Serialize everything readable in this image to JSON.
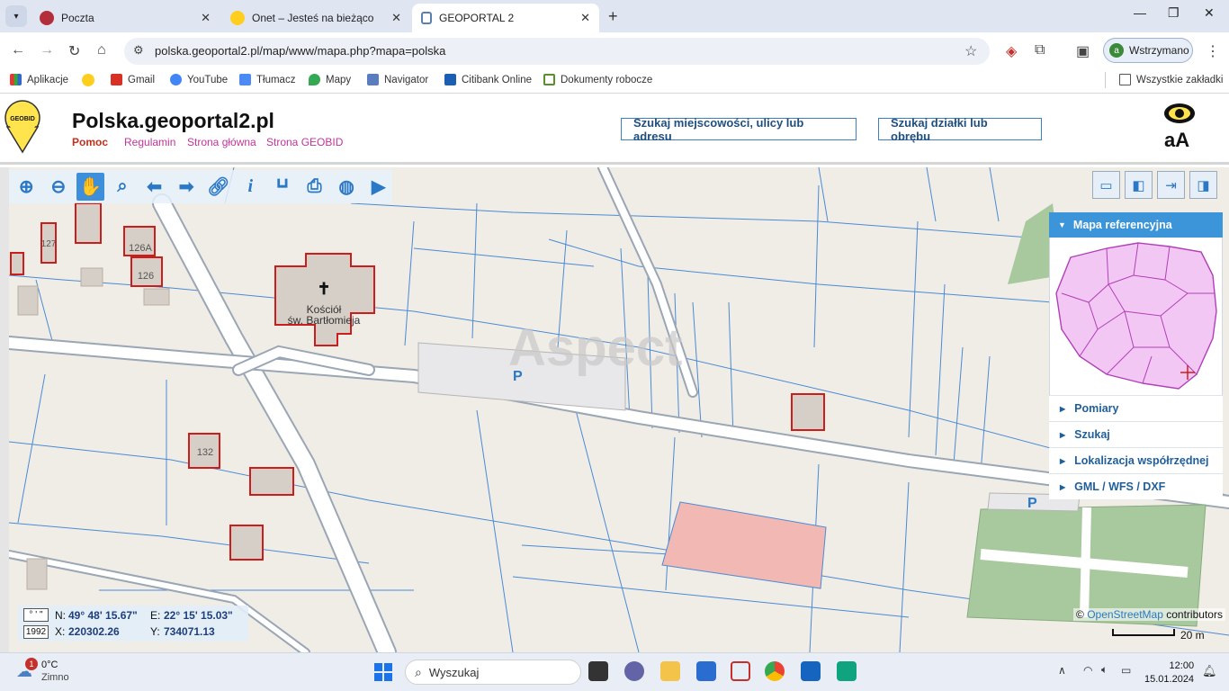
{
  "browser": {
    "tabs": [
      {
        "title": "Poczta",
        "active": false,
        "favicon_color": "#b32d3a"
      },
      {
        "title": "Onet – Jesteś na bieżąco",
        "active": false,
        "favicon_color": "#ffce1f"
      },
      {
        "title": "GEOPORTAL 2",
        "active": true,
        "favicon_color": "#5b7fb0"
      }
    ],
    "url": "polska.geoportal2.pl/map/www/mapa.php?mapa=polska",
    "profile_initial": "a",
    "profile_label": "Wstrzymano",
    "bookmarks": [
      {
        "label": "Aplikacje",
        "icon": "apps-icon"
      },
      {
        "label": "",
        "icon": "onet-dot-icon"
      },
      {
        "label": "Gmail",
        "icon": "gmail-icon"
      },
      {
        "label": "YouTube",
        "icon": "google-icon"
      },
      {
        "label": "Tłumacz",
        "icon": "translate-icon"
      },
      {
        "label": "Mapy",
        "icon": "maps-pin-icon"
      },
      {
        "label": "Navigator",
        "icon": "navigator-icon"
      },
      {
        "label": "Citibank Online",
        "icon": "citi-icon"
      },
      {
        "label": "Dokumenty robocze",
        "icon": "doc-icon"
      }
    ],
    "all_bookmarks": "Wszystkie zakładki"
  },
  "site": {
    "logo_text": "GEOBID",
    "title": "Polska.geoportal2.pl",
    "links": [
      "Pomoc",
      "Regulamin",
      "Strona główna",
      "Strona GEOBID"
    ],
    "search_place_button": "Szukaj miejscowości, ulicy lub adresu",
    "search_parcel_button": "Szukaj działki lub obrębu",
    "accessibility_label": "aA"
  },
  "map": {
    "watermark": "Aspect",
    "labels": {
      "church": "Kościół",
      "church_name": "św. Bartłomieja",
      "house_126a": "126A",
      "house_126": "126",
      "house_132": "132",
      "house_127": "127",
      "parking": "P"
    },
    "tools": [
      "zoom-in",
      "zoom-out",
      "pan",
      "zoom-box",
      "back",
      "forward",
      "link",
      "info",
      "measure",
      "print",
      "globe",
      "camera"
    ],
    "panel": {
      "header": "Mapa referencyjna",
      "items": [
        "Pomiary",
        "Szukaj",
        "Lokalizacja współrzędnej",
        "GML / WFS / DXF"
      ]
    },
    "coords": {
      "format_label": "° ' \"",
      "system_label": "1992",
      "n_label": "N:",
      "n_value": "49° 48' 15.67\"",
      "e_label": "E:",
      "e_value": "22° 15' 15.03\"",
      "x_label": "X:",
      "x_value": "220302.26",
      "y_label": "Y:",
      "y_value": "734071.13"
    },
    "attribution_prefix": "©",
    "attribution_link": "OpenStreetMap",
    "attribution_suffix": "contributors",
    "scale": "20 m"
  },
  "taskbar": {
    "temperature": "0°C",
    "weather": "Zimno",
    "notification_count": "1",
    "search_placeholder": "Wyszukaj",
    "time": "12:00",
    "date": "15.01.2024"
  }
}
